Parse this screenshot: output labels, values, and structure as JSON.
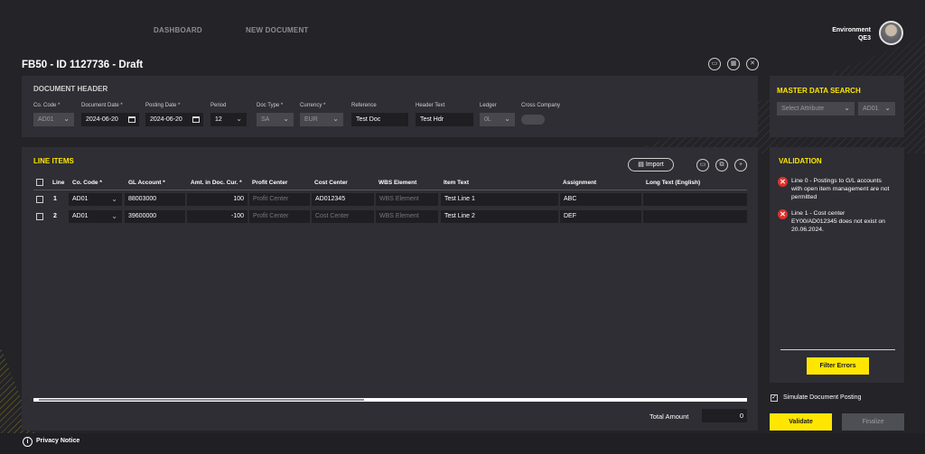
{
  "nav": {
    "dashboard": "DASHBOARD",
    "new_document": "NEW DOCUMENT"
  },
  "environment": {
    "label": "Environment",
    "value": "QE3"
  },
  "page_title": "FB50 - ID 1127736 - Draft",
  "header": {
    "title": "DOCUMENT HEADER",
    "co_code": {
      "label": "Co. Code *",
      "value": "AD01"
    },
    "document_date": {
      "label": "Document Date *",
      "value": "2024-06-20"
    },
    "posting_date": {
      "label": "Posting Date *",
      "value": "2024-06-20"
    },
    "period": {
      "label": "Period",
      "value": "12"
    },
    "doc_type": {
      "label": "Doc Type *",
      "value": "SA"
    },
    "currency": {
      "label": "Currency *",
      "value": "EUR"
    },
    "reference": {
      "label": "Reference",
      "value": "Test Doc"
    },
    "header_text": {
      "label": "Header Text",
      "value": "Test Hdr"
    },
    "ledger": {
      "label": "Ledger",
      "value": "0L"
    },
    "cross_company": {
      "label": "Cross Company"
    }
  },
  "master_data": {
    "title": "MASTER DATA SEARCH",
    "attribute_placeholder": "Select Attribute",
    "company": "AD01"
  },
  "line_items": {
    "title": "LINE ITEMS",
    "import_label": "Import",
    "columns": {
      "line": "Line",
      "co_code": "Co. Code *",
      "gl_account": "GL Account *",
      "amount": "Amt. in Doc. Cur. *",
      "profit_center": "Profit Center",
      "cost_center": "Cost Center",
      "wbs": "WBS Element",
      "item_text": "Item Text",
      "assignment": "Assignment",
      "long_text": "Long Text (English)"
    },
    "rows": [
      {
        "line": "1",
        "co_code": "AD01",
        "gl_account": "88003000",
        "amount": "100",
        "profit_center": "Profit Center",
        "cost_center": "AD012345",
        "wbs": "WBS Element",
        "item_text": "Test Line 1",
        "assignment": "ABC",
        "long_text": ""
      },
      {
        "line": "2",
        "co_code": "AD01",
        "gl_account": "39600000",
        "amount": "-100",
        "profit_center": "Profit Center",
        "cost_center": "Cost Center",
        "wbs": "WBS Element",
        "item_text": "Test Line 2",
        "assignment": "DEF",
        "long_text": ""
      }
    ],
    "total_label": "Total Amount",
    "total_value": "0"
  },
  "validation": {
    "title": "VALIDATION",
    "errors": [
      "Line 0 - Postings to G/L accounts with open item management are not permitted",
      "Line 1 - Cost center EY00/AD012345 does not exist on 20.06.2024."
    ],
    "filter_label": "Filter Errors",
    "simulate_label": "Simulate Document Posting",
    "validate_label": "Validate",
    "finalize_label": "Finalize"
  },
  "footer": {
    "privacy": "Privacy Notice"
  },
  "colors": {
    "accent": "#ffe600",
    "background": "#232328",
    "panel": "#2e2e34",
    "error": "#e0302b"
  }
}
